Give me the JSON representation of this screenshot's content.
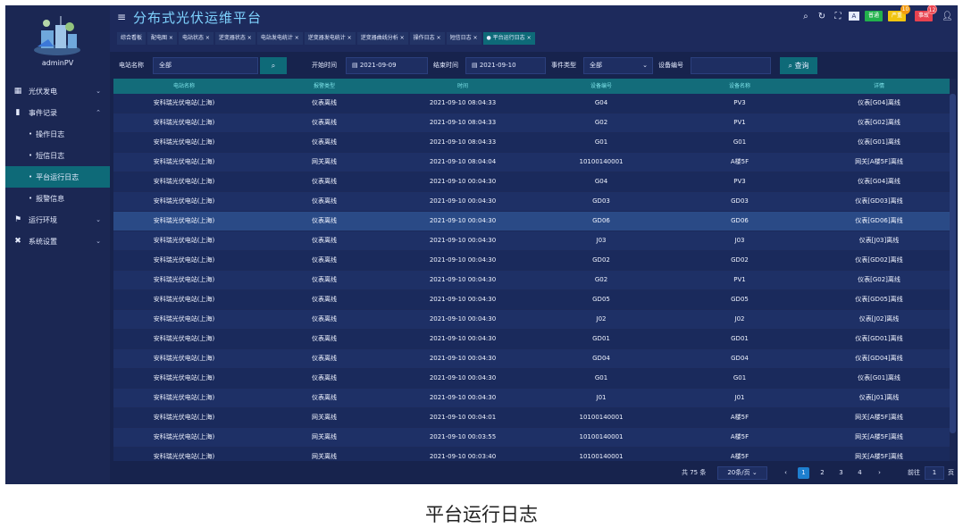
{
  "app": {
    "title": "分布式光伏运维平台",
    "username": "adminPV",
    "accent": "#0e6a78"
  },
  "sidebar": {
    "items": [
      {
        "label": "光伏发电",
        "icon": "grid-icon"
      },
      {
        "label": "事件记录",
        "icon": "book-icon"
      },
      {
        "label": "运行环境",
        "icon": "sign-icon"
      },
      {
        "label": "系统设置",
        "icon": "wrench-icon"
      }
    ],
    "sub_items": [
      {
        "label": "操作日志"
      },
      {
        "label": "短信日志"
      },
      {
        "label": "平台运行日志"
      },
      {
        "label": "报警信息"
      }
    ]
  },
  "tabs": [
    {
      "label": "综合看板"
    },
    {
      "label": "配电图 ×"
    },
    {
      "label": "电站状态 ×"
    },
    {
      "label": "逆变器状态 ×"
    },
    {
      "label": "电站发电统计 ×"
    },
    {
      "label": "逆变器发电统计 ×"
    },
    {
      "label": "逆变器曲线分析 ×"
    },
    {
      "label": "操作日志 ×"
    },
    {
      "label": "短信日志 ×"
    },
    {
      "label": "● 平台运行日志 ×"
    }
  ],
  "header": {
    "badge_green": "普通",
    "badge_yellow": "严重",
    "badge_yellow_count": "10",
    "badge_red": "事故",
    "badge_red_count": "12"
  },
  "filters": {
    "station_label": "电站名称",
    "station_value": "全部",
    "start_label": "开始时间",
    "start_value": "2021-09-09",
    "end_label": "结束时间",
    "end_value": "2021-09-10",
    "event_type_label": "事件类型",
    "event_type_value": "全部",
    "device_no_label": "设备编号",
    "device_no_value": "",
    "query_label": "查询"
  },
  "table": {
    "headers": [
      "电站名称",
      "报警类型",
      "时间",
      "设备编号",
      "设备名称",
      "详情"
    ],
    "rows": [
      [
        "安科瑞光伏电站(上海)",
        "仪表离线",
        "2021-09-10 08:04:33",
        "G04",
        "PV3",
        "仪表[G04]离线"
      ],
      [
        "安科瑞光伏电站(上海)",
        "仪表离线",
        "2021-09-10 08:04:33",
        "G02",
        "PV1",
        "仪表[G02]离线"
      ],
      [
        "安科瑞光伏电站(上海)",
        "仪表离线",
        "2021-09-10 08:04:33",
        "G01",
        "G01",
        "仪表[G01]离线"
      ],
      [
        "安科瑞光伏电站(上海)",
        "网关离线",
        "2021-09-10 08:04:04",
        "10100140001",
        "A楼5F",
        "网关[A楼5F]离线"
      ],
      [
        "安科瑞光伏电站(上海)",
        "仪表离线",
        "2021-09-10 00:04:30",
        "G04",
        "PV3",
        "仪表[G04]离线"
      ],
      [
        "安科瑞光伏电站(上海)",
        "仪表离线",
        "2021-09-10 00:04:30",
        "GD03",
        "GD03",
        "仪表[GD03]离线"
      ],
      [
        "安科瑞光伏电站(上海)",
        "仪表离线",
        "2021-09-10 00:04:30",
        "GD06",
        "GD06",
        "仪表[GD06]离线"
      ],
      [
        "安科瑞光伏电站(上海)",
        "仪表离线",
        "2021-09-10 00:04:30",
        "J03",
        "J03",
        "仪表[J03]离线"
      ],
      [
        "安科瑞光伏电站(上海)",
        "仪表离线",
        "2021-09-10 00:04:30",
        "GD02",
        "GD02",
        "仪表[GD02]离线"
      ],
      [
        "安科瑞光伏电站(上海)",
        "仪表离线",
        "2021-09-10 00:04:30",
        "G02",
        "PV1",
        "仪表[G02]离线"
      ],
      [
        "安科瑞光伏电站(上海)",
        "仪表离线",
        "2021-09-10 00:04:30",
        "GD05",
        "GD05",
        "仪表[GD05]离线"
      ],
      [
        "安科瑞光伏电站(上海)",
        "仪表离线",
        "2021-09-10 00:04:30",
        "J02",
        "J02",
        "仪表[J02]离线"
      ],
      [
        "安科瑞光伏电站(上海)",
        "仪表离线",
        "2021-09-10 00:04:30",
        "GD01",
        "GD01",
        "仪表[GD01]离线"
      ],
      [
        "安科瑞光伏电站(上海)",
        "仪表离线",
        "2021-09-10 00:04:30",
        "GD04",
        "GD04",
        "仪表[GD04]离线"
      ],
      [
        "安科瑞光伏电站(上海)",
        "仪表离线",
        "2021-09-10 00:04:30",
        "G01",
        "G01",
        "仪表[G01]离线"
      ],
      [
        "安科瑞光伏电站(上海)",
        "仪表离线",
        "2021-09-10 00:04:30",
        "J01",
        "J01",
        "仪表[J01]离线"
      ],
      [
        "安科瑞光伏电站(上海)",
        "网关离线",
        "2021-09-10 00:04:01",
        "10100140001",
        "A楼5F",
        "网关[A楼5F]离线"
      ],
      [
        "安科瑞光伏电站(上海)",
        "网关离线",
        "2021-09-10 00:03:55",
        "10100140001",
        "A楼5F",
        "网关[A楼5F]离线"
      ],
      [
        "安科瑞光伏电站(上海)",
        "网关离线",
        "2021-09-10 00:03:40",
        "10100140001",
        "A楼5F",
        "网关[A楼5F]离线"
      ]
    ]
  },
  "pager": {
    "total": "共 75 条",
    "page_size": "20条/页",
    "pages": [
      "1",
      "2",
      "3",
      "4"
    ],
    "current": "1",
    "goto_label": "前往",
    "goto_value": "1",
    "page_suffix": "页"
  },
  "caption": "平台运行日志"
}
